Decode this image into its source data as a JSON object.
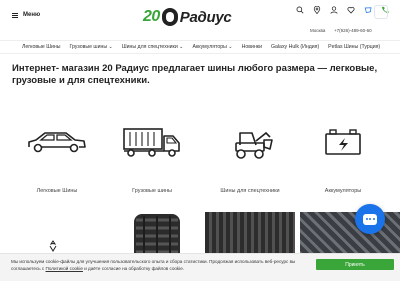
{
  "header": {
    "menu_label": "Меню",
    "logo_number": "20",
    "logo_word": "Радиус",
    "city": "Москва",
    "phone": "+7(926)-489-60-60",
    "icons": [
      "search-icon",
      "location-icon",
      "user-icon",
      "heart-icon",
      "cart-icon",
      "phone-icon"
    ]
  },
  "nav": {
    "items": [
      "Легковые Шины",
      "Грузовые шины ⌄",
      "Шины для спецтехники ⌄",
      "Аккумуляторы ⌄",
      "Новинки",
      "Galaxy Hulk (Индия)",
      "Petlas Шины (Турция)"
    ]
  },
  "main": {
    "headline": "Интернет- магазин 20 Радиус предлагает шины любого размера — легковые, грузовые и для спецтехники.",
    "categories": [
      {
        "label": "Легковые Шины",
        "icon": "car-icon"
      },
      {
        "label": "Грузовые шины",
        "icon": "truck-icon"
      },
      {
        "label": "Шины для спецтехники",
        "icon": "loader-icon"
      },
      {
        "label": "Аккумуляторы",
        "icon": "battery-icon"
      }
    ]
  },
  "cookie": {
    "text_before": "Мы используем cookie-файлы для улучшения пользовательского опыта и сбора статистики. Продолжая использовать веб-ресурс вы соглашаетесь с ",
    "link": "Политикой cookie",
    "text_after": " и даёте согласие на обработку файлов cookie.",
    "accept_label": "Принять"
  },
  "colors": {
    "accent": "#3aa63a",
    "chat": "#1a73e8"
  }
}
